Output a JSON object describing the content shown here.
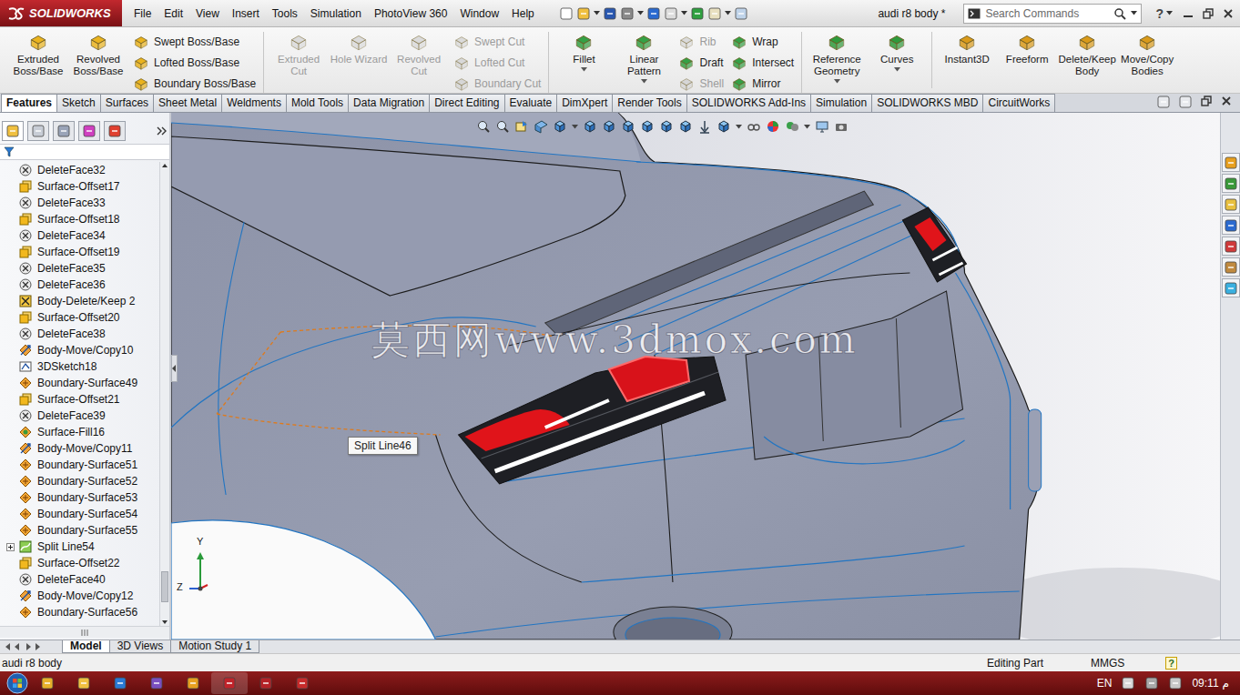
{
  "app": {
    "logo": "SOLIDWORKS",
    "menus": [
      "File",
      "Edit",
      "View",
      "Insert",
      "Tools",
      "Simulation",
      "PhotoView 360",
      "Window",
      "Help"
    ],
    "document_title": "audi r8 body *",
    "search_placeholder": "Search Commands",
    "help": "?"
  },
  "command_groups": [
    {
      "columns": [
        {
          "kind": "large",
          "items": [
            {
              "label": "Extruded Boss/Base",
              "disabled": false,
              "dropdown": false
            },
            {
              "label": "Revolved Boss/Base",
              "disabled": false,
              "dropdown": false
            }
          ]
        },
        {
          "kind": "stack",
          "items": [
            {
              "label": "Swept Boss/Base",
              "disabled": false,
              "dropdown": false
            },
            {
              "label": "Lofted Boss/Base",
              "disabled": false,
              "dropdown": false
            },
            {
              "label": "Boundary Boss/Base",
              "disabled": false,
              "dropdown": false
            }
          ]
        }
      ]
    },
    {
      "columns": [
        {
          "kind": "large",
          "items": [
            {
              "label": "Extruded Cut",
              "disabled": true,
              "dropdown": false
            },
            {
              "label": "Hole Wizard",
              "disabled": true,
              "dropdown": false
            },
            {
              "label": "Revolved Cut",
              "disabled": true,
              "dropdown": false
            }
          ]
        },
        {
          "kind": "stack",
          "items": [
            {
              "label": "Swept Cut",
              "disabled": true,
              "dropdown": false
            },
            {
              "label": "Lofted Cut",
              "disabled": true,
              "dropdown": false
            },
            {
              "label": "Boundary Cut",
              "disabled": true,
              "dropdown": false
            }
          ]
        }
      ]
    },
    {
      "columns": [
        {
          "kind": "large",
          "items": [
            {
              "label": "Fillet",
              "disabled": false,
              "dropdown": true
            },
            {
              "label": "Linear Pattern",
              "disabled": false,
              "dropdown": true
            }
          ]
        },
        {
          "kind": "stack",
          "items": [
            {
              "label": "Rib",
              "disabled": true,
              "dropdown": false
            },
            {
              "label": "Draft",
              "disabled": false,
              "dropdown": false
            },
            {
              "label": "Shell",
              "disabled": true,
              "dropdown": false
            }
          ]
        },
        {
          "kind": "stack",
          "items": [
            {
              "label": "Wrap",
              "disabled": false,
              "dropdown": false
            },
            {
              "label": "Intersect",
              "disabled": false,
              "dropdown": false
            },
            {
              "label": "Mirror",
              "disabled": false,
              "dropdown": false
            }
          ]
        }
      ]
    },
    {
      "columns": [
        {
          "kind": "large",
          "items": [
            {
              "label": "Reference Geometry",
              "disabled": false,
              "dropdown": true
            },
            {
              "label": "Curves",
              "disabled": false,
              "dropdown": true
            }
          ]
        }
      ]
    },
    {
      "columns": [
        {
          "kind": "large",
          "items": [
            {
              "label": "Instant3D",
              "disabled": false,
              "dropdown": false
            },
            {
              "label": "Freeform",
              "disabled": false,
              "dropdown": false
            },
            {
              "label": "Delete/Keep Body",
              "disabled": false,
              "dropdown": false
            },
            {
              "label": "Move/Copy Bodies",
              "disabled": false,
              "dropdown": false
            }
          ]
        }
      ]
    }
  ],
  "tabs": [
    {
      "label": "Features",
      "selected": true
    },
    {
      "label": "Sketch",
      "selected": false
    },
    {
      "label": "Surfaces",
      "selected": false
    },
    {
      "label": "Sheet Metal",
      "selected": false
    },
    {
      "label": "Weldments",
      "selected": false
    },
    {
      "label": "Mold Tools",
      "selected": false
    },
    {
      "label": "Data Migration",
      "selected": false
    },
    {
      "label": "Direct Editing",
      "selected": false
    },
    {
      "label": "Evaluate",
      "selected": false
    },
    {
      "label": "DimXpert",
      "selected": false
    },
    {
      "label": "Render Tools",
      "selected": false
    },
    {
      "label": "SOLIDWORKS Add-Ins",
      "selected": false
    },
    {
      "label": "Simulation",
      "selected": false
    },
    {
      "label": "SOLIDWORKS MBD",
      "selected": false
    },
    {
      "label": "CircuitWorks",
      "selected": false
    }
  ],
  "feature_tree": [
    {
      "label": "DeleteFace32",
      "kind": "delete-face",
      "expandable": false
    },
    {
      "label": "Surface-Offset17",
      "kind": "offset",
      "expandable": false
    },
    {
      "label": "DeleteFace33",
      "kind": "delete-face",
      "expandable": false
    },
    {
      "label": "Surface-Offset18",
      "kind": "offset",
      "expandable": false
    },
    {
      "label": "DeleteFace34",
      "kind": "delete-face",
      "expandable": false
    },
    {
      "label": "Surface-Offset19",
      "kind": "offset",
      "expandable": false
    },
    {
      "label": "DeleteFace35",
      "kind": "delete-face",
      "expandable": false
    },
    {
      "label": "DeleteFace36",
      "kind": "delete-face",
      "expandable": false
    },
    {
      "label": "Body-Delete/Keep 2",
      "kind": "body-delete",
      "expandable": false
    },
    {
      "label": "Surface-Offset20",
      "kind": "offset",
      "expandable": false
    },
    {
      "label": "DeleteFace38",
      "kind": "delete-face",
      "expandable": false
    },
    {
      "label": "Body-Move/Copy10",
      "kind": "move-copy",
      "expandable": false
    },
    {
      "label": "3DSketch18",
      "kind": "sketch3d",
      "expandable": false
    },
    {
      "label": "Boundary-Surface49",
      "kind": "boundary",
      "expandable": false
    },
    {
      "label": "Surface-Offset21",
      "kind": "offset",
      "expandable": false
    },
    {
      "label": "DeleteFace39",
      "kind": "delete-face",
      "expandable": false
    },
    {
      "label": "Surface-Fill16",
      "kind": "fill",
      "expandable": false
    },
    {
      "label": "Body-Move/Copy11",
      "kind": "move-copy",
      "expandable": false
    },
    {
      "label": "Boundary-Surface51",
      "kind": "boundary",
      "expandable": false
    },
    {
      "label": "Boundary-Surface52",
      "kind": "boundary",
      "expandable": false
    },
    {
      "label": "Boundary-Surface53",
      "kind": "boundary",
      "expandable": false
    },
    {
      "label": "Boundary-Surface54",
      "kind": "boundary",
      "expandable": false
    },
    {
      "label": "Boundary-Surface55",
      "kind": "boundary",
      "expandable": false
    },
    {
      "label": "Split Line54",
      "kind": "split-line",
      "expandable": true
    },
    {
      "label": "Surface-Offset22",
      "kind": "offset",
      "expandable": false
    },
    {
      "label": "DeleteFace40",
      "kind": "delete-face",
      "expandable": false
    },
    {
      "label": "Body-Move/Copy12",
      "kind": "move-copy",
      "expandable": false
    },
    {
      "label": "Boundary-Surface56",
      "kind": "boundary",
      "expandable": false
    }
  ],
  "viewport": {
    "tooltip": "Split Line46",
    "watermark": "莫西网www.3dmox.com",
    "axes": [
      "Y",
      "Z"
    ]
  },
  "bottom_tabs": [
    {
      "label": "Model",
      "selected": true
    },
    {
      "label": "3D Views",
      "selected": false
    },
    {
      "label": "Motion Study 1",
      "selected": false
    }
  ],
  "status_bar": {
    "document": "audi r8 body",
    "mode": "Editing Part",
    "units": "MMGS",
    "help": "?"
  },
  "taskbar": {
    "language": "EN",
    "time": "09:11",
    "period": "م"
  }
}
